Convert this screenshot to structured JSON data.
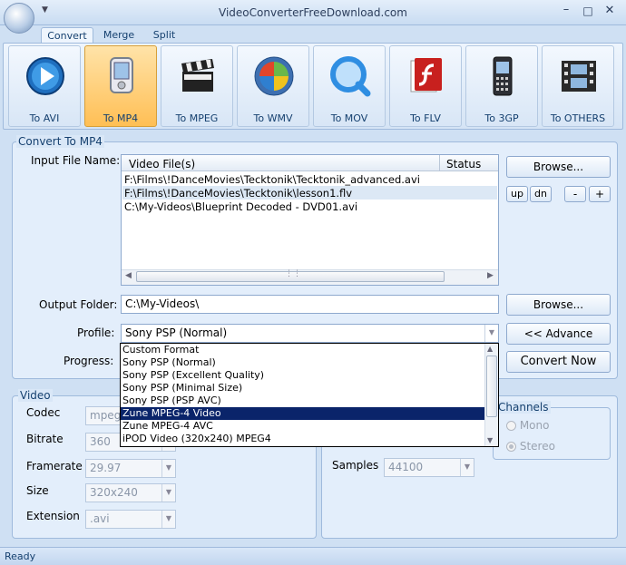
{
  "window": {
    "title": "VideoConverterFreeDownload.com",
    "minimize_glyph": "–",
    "maximize_glyph": "□",
    "close_glyph": "✕"
  },
  "tabs": [
    {
      "label": "Convert"
    },
    {
      "label": "Merge"
    },
    {
      "label": "Split"
    }
  ],
  "ribbon": {
    "buttons": [
      {
        "label": "To AVI"
      },
      {
        "label": "To MP4"
      },
      {
        "label": "To MPEG"
      },
      {
        "label": "To WMV"
      },
      {
        "label": "To MOV"
      },
      {
        "label": "To FLV"
      },
      {
        "label": "To 3GP"
      },
      {
        "label": "To OTHERS"
      }
    ]
  },
  "convert": {
    "group_title": "Convert To MP4",
    "input_label": "Input File Name:",
    "col_file": "Video File(s)",
    "col_status": "Status",
    "files": [
      "F:\\Films\\!DanceMovies\\Tecktonik\\Tecktonik_advanced.avi",
      "F:\\Films\\!DanceMovies\\Tecktonik\\lesson1.flv",
      "C:\\My-Videos\\Blueprint Decoded - DVD01.avi"
    ],
    "browse_label": "Browse...",
    "up_label": "up",
    "dn_label": "dn",
    "minus_label": "-",
    "plus_label": "+",
    "output_label": "Output Folder:",
    "output_value": "C:\\My-Videos\\",
    "browse2_label": "Browse...",
    "profile_label": "Profile:",
    "profile_value": "Sony PSP (Normal)",
    "advance_label": "<< Advance",
    "progress_label": "Progress:",
    "convert_now_label": "Convert Now",
    "profile_options": [
      "Custom Format",
      "Sony PSP (Normal)",
      "Sony PSP (Excellent Quality)",
      "Sony PSP (Minimal Size)",
      "Sony PSP (PSP AVC)",
      "Zune MPEG-4 Video",
      "Zune MPEG-4 AVC",
      "iPOD Video (320x240) MPEG4"
    ]
  },
  "video": {
    "group_title": "Video",
    "codec_label": "Codec",
    "codec_value": "mpeg4",
    "bitrate_label": "Bitrate",
    "bitrate_value": "360",
    "framerate_label": "Framerate",
    "framerate_value": "29.97",
    "size_label": "Size",
    "size_value": "320x240",
    "extension_label": "Extension",
    "extension_value": ".avi"
  },
  "audio": {
    "samples_label": "Samples",
    "samples_value": "44100",
    "channels_title": "Channels",
    "mono_label": "Mono",
    "stereo_label": "Stereo"
  },
  "status": {
    "text": "Ready"
  }
}
